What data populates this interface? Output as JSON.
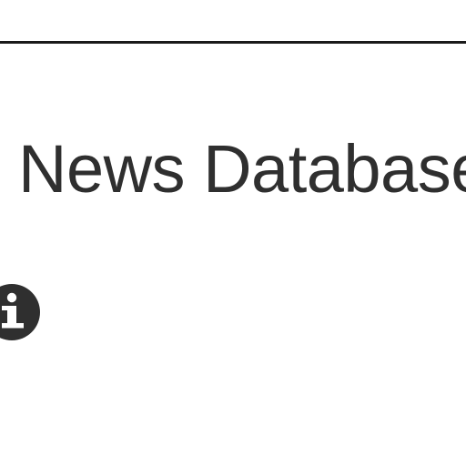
{
  "header": {
    "title": "News Database"
  },
  "info": {
    "icon": "info-icon",
    "icon_color": "#2f2f2f",
    "glyph_color": "#ffffff"
  }
}
